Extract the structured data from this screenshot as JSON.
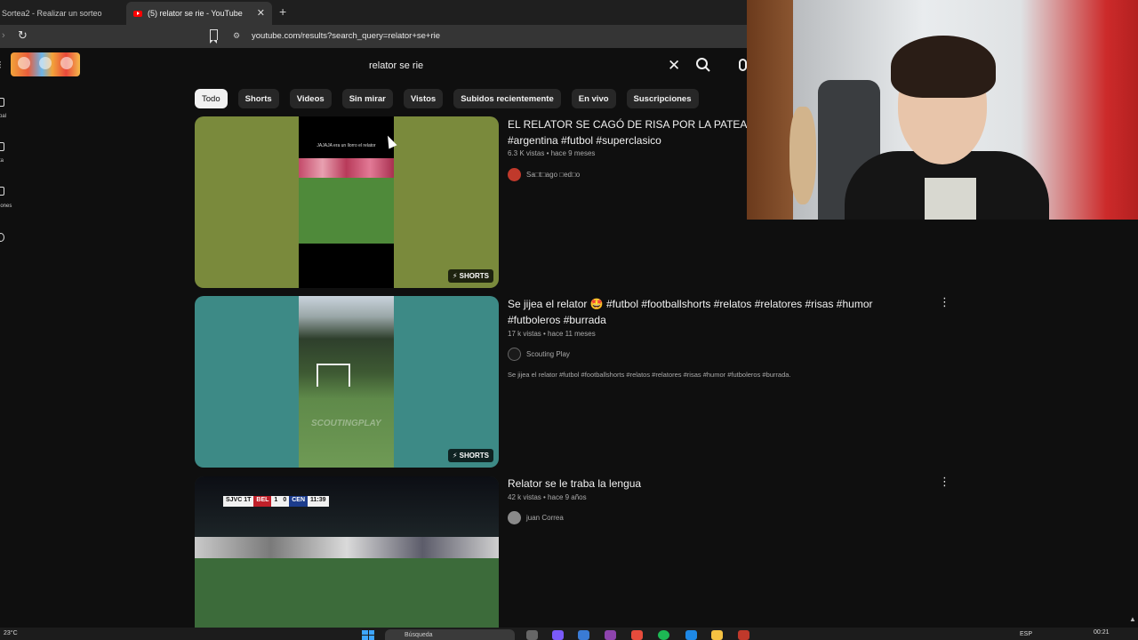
{
  "browser": {
    "tabs": [
      {
        "label": "Sortea2 - Realizar un sorteo"
      },
      {
        "label": "(5) relator se rie - YouTube"
      }
    ],
    "url": "youtube.com/results?search_query=relator+se+rie"
  },
  "header": {
    "search_query": "relator se rie"
  },
  "sidebar": {
    "labels": [
      "pal",
      "ta",
      "iones"
    ]
  },
  "chips": [
    {
      "label": "Todo",
      "active": true
    },
    {
      "label": "Shorts"
    },
    {
      "label": "Videos"
    },
    {
      "label": "Sin mirar"
    },
    {
      "label": "Vistos"
    },
    {
      "label": "Subidos recientemente"
    },
    {
      "label": "En vivo"
    },
    {
      "label": "Suscripciones"
    }
  ],
  "results": [
    {
      "title_line1": "EL RELATOR SE CAGÓ DE RISA POR LA PATEADA",
      "title_line2": "#argentina #futbol #superclasico",
      "meta": "6.3 K vistas • hace 9 meses",
      "channel": "Sa□t□ago □ed□o",
      "badge": "SHORTS",
      "thumb_caption": "JAJAJA era un llorro el relator",
      "avatar_color": "#c0392b"
    },
    {
      "title_line1": "Se jijea el relator 🤩 #futbol #footballshorts #relatos #relatores #risas #humor",
      "title_line2": "#futboleros #burrada",
      "meta": "17 k vistas • hace 11 meses",
      "channel": "Scouting Play",
      "description": "Se jijea el relator #futbol #footballshorts #relatos #relatores #risas #humor #futboleros #burrada.",
      "badge": "SHORTS",
      "watermark": "SCOUTINGPLAY",
      "avatar_color": "#1a1a1a"
    },
    {
      "title_line1": "Relator se le traba la lengua",
      "meta": "42 k vistas • hace 9 años",
      "channel": "juan Correa",
      "avatar_color": "#8a8a8a",
      "scoreboard": {
        "clock_label": "SJVC 1T",
        "home": "BEL",
        "home_score": "1",
        "away_score": "0",
        "away": "CEN",
        "time": "11:39"
      }
    }
  ],
  "taskbar": {
    "temperature": "23°C",
    "search_placeholder": "Búsqueda",
    "language": "ESP",
    "time": "00:21"
  }
}
